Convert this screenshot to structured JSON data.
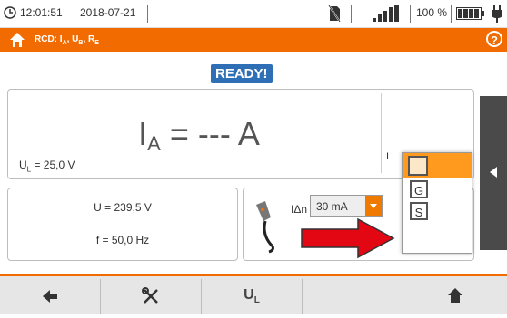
{
  "statusbar": {
    "time": "12:01:51",
    "date": "2018-07-21",
    "battery_percent": "100 %"
  },
  "titlebar": {
    "title": "RCD: I",
    "title_sub_a": "A",
    "title_mid1": ", U",
    "title_sub_b": "B",
    "title_mid2": ", R",
    "title_sub_e": "E",
    "help_label": "?"
  },
  "status": {
    "ready_label": "READY!"
  },
  "main": {
    "result_prefix": "I",
    "result_sub": "A",
    "result_value": " = --- A",
    "ul_prefix": "U",
    "ul_sub": "L",
    "ul_value": " = 25,0 V",
    "ia_label_partial": "I"
  },
  "measurements": {
    "voltage": "U = 239,5 V",
    "frequency": "f = 50,0 Hz"
  },
  "settings": {
    "idn_label": "IΔn",
    "idn_value": "30 mA"
  },
  "popup": {
    "options": [
      "",
      "G",
      "S"
    ]
  },
  "bottombar": {
    "ul_prefix": "U",
    "ul_sub": "L"
  },
  "colors": {
    "accent": "#f26b00",
    "ready": "#2f6fb6",
    "arrow": "#e30613"
  }
}
